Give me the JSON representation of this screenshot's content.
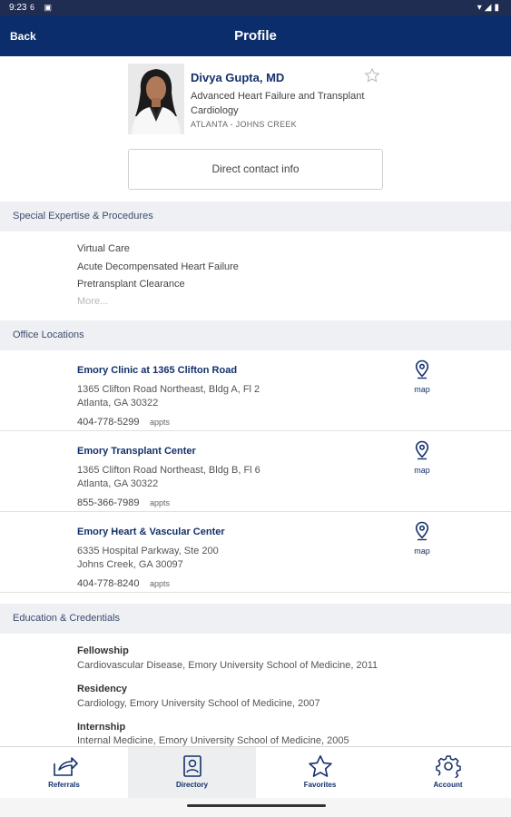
{
  "status_bar": {
    "time": "9:23",
    "icons_left": "6 ▣",
    "icons_right": "▾◢▮"
  },
  "header": {
    "back_label": "Back",
    "title": "Profile"
  },
  "profile": {
    "name": "Divya Gupta, MD",
    "specialty": "Advanced Heart Failure and Transplant Cardiology",
    "location": "ATLANTA - JOHNS CREEK",
    "contact_button": "Direct contact info"
  },
  "expertise": {
    "heading": "Special Expertise & Procedures",
    "items": [
      "Virtual Care",
      "Acute Decompensated Heart Failure",
      "Pretransplant Clearance"
    ],
    "more": "More..."
  },
  "offices": {
    "heading": "Office Locations",
    "map_label": "map",
    "appts_label": "appts",
    "items": [
      {
        "name": "Emory Clinic at 1365 Clifton Road",
        "address1": "1365 Clifton Road Northeast, Bldg A, Fl 2",
        "address2": "Atlanta, GA 30322",
        "phone": "404-778-5299"
      },
      {
        "name": "Emory Transplant Center",
        "address1": "1365 Clifton Road Northeast, Bldg B, Fl 6",
        "address2": "Atlanta, GA 30322",
        "phone": "855-366-7989"
      },
      {
        "name": "Emory Heart & Vascular Center",
        "address1": "6335 Hospital Parkway, Ste 200",
        "address2": "Johns Creek, GA 30097",
        "phone": "404-778-8240"
      }
    ]
  },
  "education": {
    "heading": "Education & Credentials",
    "items": [
      {
        "title": "Fellowship",
        "detail": "Cardiovascular Disease, Emory University School of Medicine, 2011"
      },
      {
        "title": "Residency",
        "detail": "Cardiology, Emory University School of Medicine, 2007"
      },
      {
        "title": "Internship",
        "detail": "Internal Medicine, Emory University School of Medicine, 2005"
      }
    ]
  },
  "tabs": [
    {
      "label": "Referrals",
      "icon": "share-icon"
    },
    {
      "label": "Directory",
      "icon": "contact-card-icon"
    },
    {
      "label": "Favorites",
      "icon": "star-icon"
    },
    {
      "label": "Account",
      "icon": "gear-icon"
    }
  ],
  "active_tab": "Directory",
  "colors": {
    "brand": "#0c2d6b",
    "section_bg": "#eef0f4"
  }
}
